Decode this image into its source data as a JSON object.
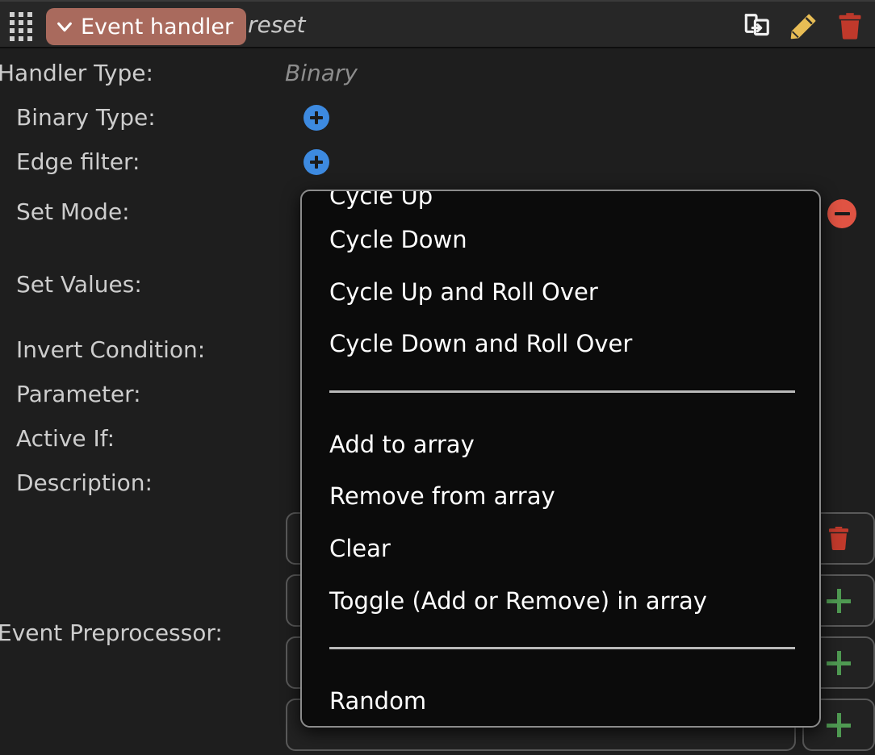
{
  "header": {
    "drag_handle": "grid-handle",
    "node_type_label": "Event handler",
    "node_name": "reset",
    "icons": {
      "duplicate": "duplicate-icon",
      "edit": "pencil-icon",
      "delete": "trash-icon"
    }
  },
  "properties": [
    {
      "label": "Handler Type:",
      "value": "Binary",
      "control": "text"
    },
    {
      "label": "Binary Type:",
      "value": "",
      "control": "add-blue"
    },
    {
      "label": "Edge filter:",
      "value": "",
      "control": "add-blue"
    },
    {
      "label": "Set Mode:",
      "value": "",
      "control": "remove-red"
    },
    {
      "label": "Set Values:",
      "value": "",
      "control": "none"
    },
    {
      "label": "Invert Condition:",
      "value": "",
      "control": "none"
    },
    {
      "label": "Parameter:",
      "value": "",
      "control": "none"
    },
    {
      "label": "Active If:",
      "value": "",
      "control": "none"
    },
    {
      "label": "Description:",
      "value": "",
      "control": "none"
    },
    {
      "label": "Event Preprocessor:",
      "value": "",
      "control": "none"
    }
  ],
  "field_rows": [
    {
      "value": "",
      "action": "delete",
      "action_icon": "trash-icon"
    },
    {
      "value": "",
      "action": "add",
      "action_icon": "plus-icon"
    },
    {
      "value": "",
      "action": "add",
      "action_icon": "plus-icon"
    },
    {
      "value": "",
      "action": "add",
      "action_icon": "plus-icon"
    }
  ],
  "dropdown": {
    "open": true,
    "items": [
      {
        "label": "Cycle Up",
        "type": "item",
        "clipped": true
      },
      {
        "label": "Cycle Down",
        "type": "item"
      },
      {
        "label": "Cycle Up and Roll Over",
        "type": "item"
      },
      {
        "label": "Cycle Down and Roll Over",
        "type": "item"
      },
      {
        "label": "",
        "type": "separator"
      },
      {
        "label": "Add to array",
        "type": "item"
      },
      {
        "label": "Remove from array",
        "type": "item"
      },
      {
        "label": "Clear",
        "type": "item"
      },
      {
        "label": "Toggle (Add or Remove) in array",
        "type": "item"
      },
      {
        "label": "",
        "type": "separator"
      },
      {
        "label": "Random",
        "type": "item"
      }
    ]
  },
  "colors": {
    "background": "#1e1e1e",
    "header_bar": "#272727",
    "node_pill": "#a96a5d",
    "add_blue": "#3d8ae0",
    "remove_red": "#e05343",
    "add_green": "#4f9a52",
    "delete_red": "#c0392b",
    "edit_yellow": "#e8bd55",
    "menu_background": "#0b0b0b",
    "menu_border": "#8b8b8b",
    "text_primary": "#cdcdcd",
    "text_muted": "#8d8d8d"
  }
}
